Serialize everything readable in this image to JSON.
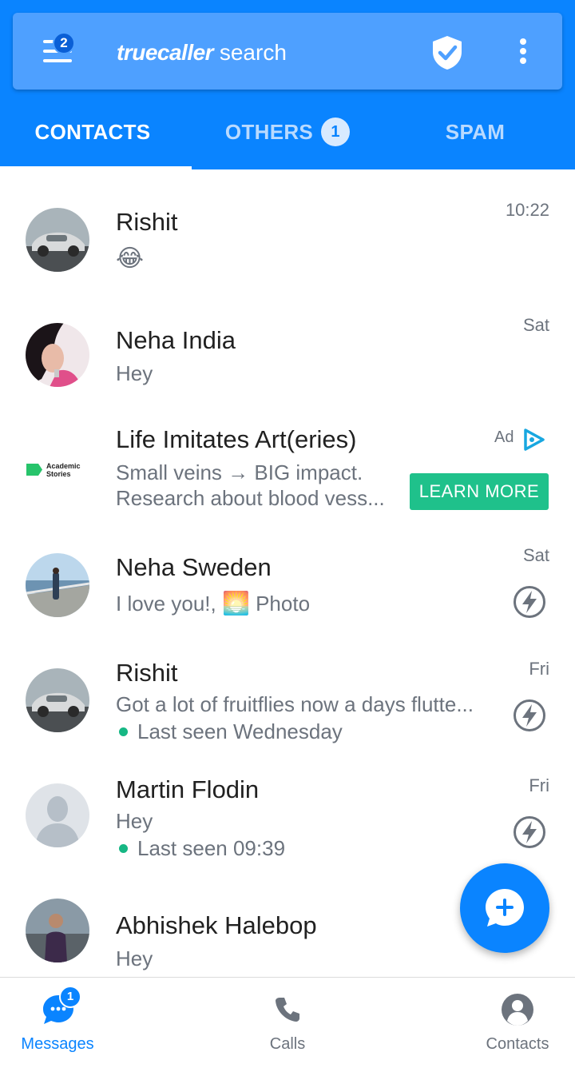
{
  "header": {
    "menu_badge": "2",
    "brand_logo": "truecaller",
    "brand_suffix": "search",
    "icons": {
      "menu": "hamburger-menu-icon",
      "shield": "shield-check-icon",
      "more": "more-vert-icon"
    }
  },
  "tabs": [
    {
      "label": "CONTACTS",
      "active": true
    },
    {
      "label": "OTHERS",
      "badge": "1"
    },
    {
      "label": "SPAM"
    }
  ],
  "conversations": [
    {
      "name": "Rishit",
      "preview_emoji": "😂",
      "time": "10:22"
    },
    {
      "name": "Neha India",
      "preview": "Hey",
      "time": "Sat"
    },
    {
      "name": "Life Imitates Art(eries)",
      "line1": "Small veins → BIG impact.",
      "line2": "Research about blood vess...",
      "ad_label": "Ad",
      "cta": "LEARN MORE",
      "advertiser": "Academic Stories",
      "is_ad": true
    },
    {
      "name": "Neha Sweden",
      "preview": "I love you!,",
      "photo_emoji": "🌅",
      "photo_label": "Photo",
      "time": "Sat",
      "flash": true
    },
    {
      "name": "Rishit",
      "preview": "Got a lot of fruitflies now a days flutte...",
      "last_seen": "Last seen Wednesday",
      "time": "Fri",
      "flash": true
    },
    {
      "name": "Martin Flodin",
      "preview": "Hey",
      "last_seen": "Last seen 09:39",
      "time": "Fri",
      "flash": true
    },
    {
      "name": "Abhishek Halebop",
      "preview": "Hey"
    }
  ],
  "fab": {
    "icon": "new-message-icon"
  },
  "bottom_nav": [
    {
      "label": "Messages",
      "badge": "1",
      "active": true,
      "icon": "chat-bubble-icon"
    },
    {
      "label": "Calls",
      "icon": "phone-icon"
    },
    {
      "label": "Contacts",
      "icon": "person-circle-icon"
    }
  ],
  "colors": {
    "primary": "#0a84ff",
    "search_bar": "#4ea0ff",
    "cta": "#1fc18b",
    "online": "#16b784"
  }
}
